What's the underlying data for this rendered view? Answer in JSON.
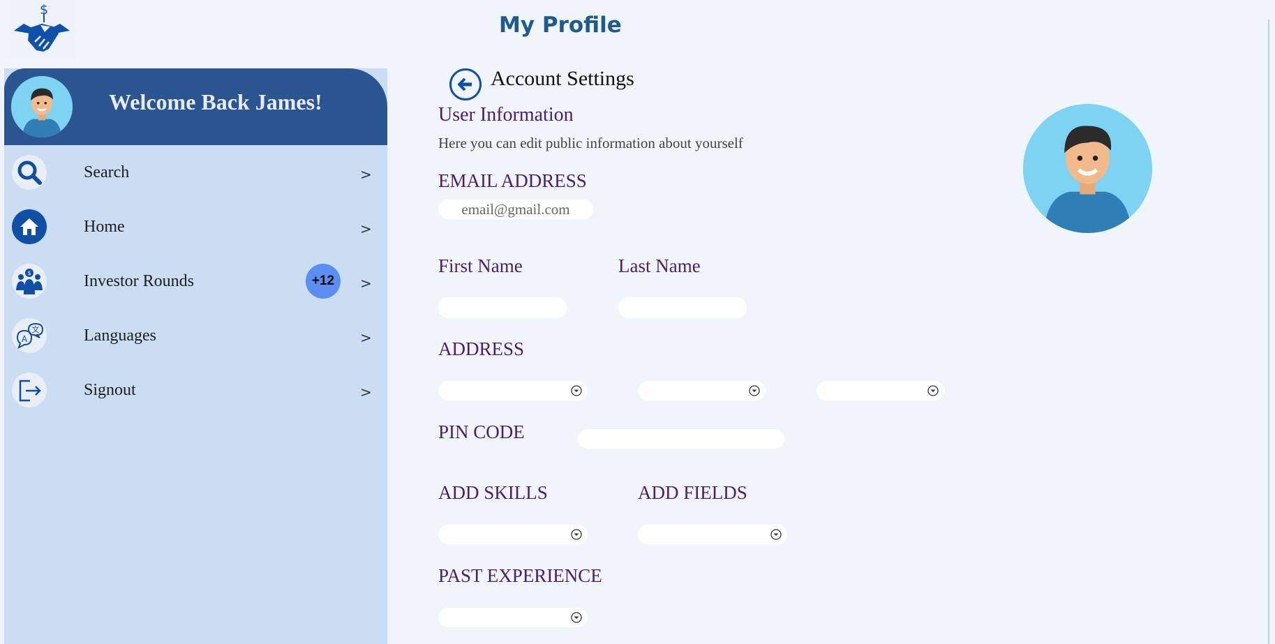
{
  "page": {
    "title": "My Profile"
  },
  "logo": {
    "icon": "handshake-dollar-icon",
    "color": "#1150a8"
  },
  "sidebar": {
    "welcome": "Welcome Back James!",
    "avatar_icon": "user-avatar-icon",
    "header_color": "#2b5591",
    "background_color": "#cbddf3",
    "items": [
      {
        "label": "Search",
        "icon": "search-icon",
        "arrow": ">"
      },
      {
        "label": "Home",
        "icon": "home-icon",
        "arrow": ">"
      },
      {
        "label": "Investor Rounds",
        "icon": "investors-icon",
        "arrow": ">",
        "badge": "+12"
      },
      {
        "label": "Languages",
        "icon": "languages-icon",
        "arrow": ">"
      },
      {
        "label": "Signout",
        "icon": "signout-icon",
        "arrow": ">"
      }
    ]
  },
  "main": {
    "settings_title": "Account Settings",
    "section_title": "User Information",
    "section_desc": "Here you can edit public information about yourself",
    "email": {
      "label": "EMAIL ADDRESS",
      "placeholder": "email@gmail.com",
      "value": ""
    },
    "first_name": {
      "label": "First Name",
      "value": ""
    },
    "last_name": {
      "label": "Last Name",
      "value": ""
    },
    "address": {
      "label": "ADDRESS",
      "selects": [
        "",
        "",
        ""
      ]
    },
    "pin_code": {
      "label": "PIN CODE",
      "value": ""
    },
    "skills": {
      "label": "ADD SKILLS",
      "value": ""
    },
    "fields": {
      "label": "ADD FIELDS",
      "value": ""
    },
    "experience": {
      "label": "PAST EXPERIENCE",
      "value": ""
    },
    "label_color": "#4a1e6e",
    "profile_picture_icon": "profile-picture-icon"
  }
}
